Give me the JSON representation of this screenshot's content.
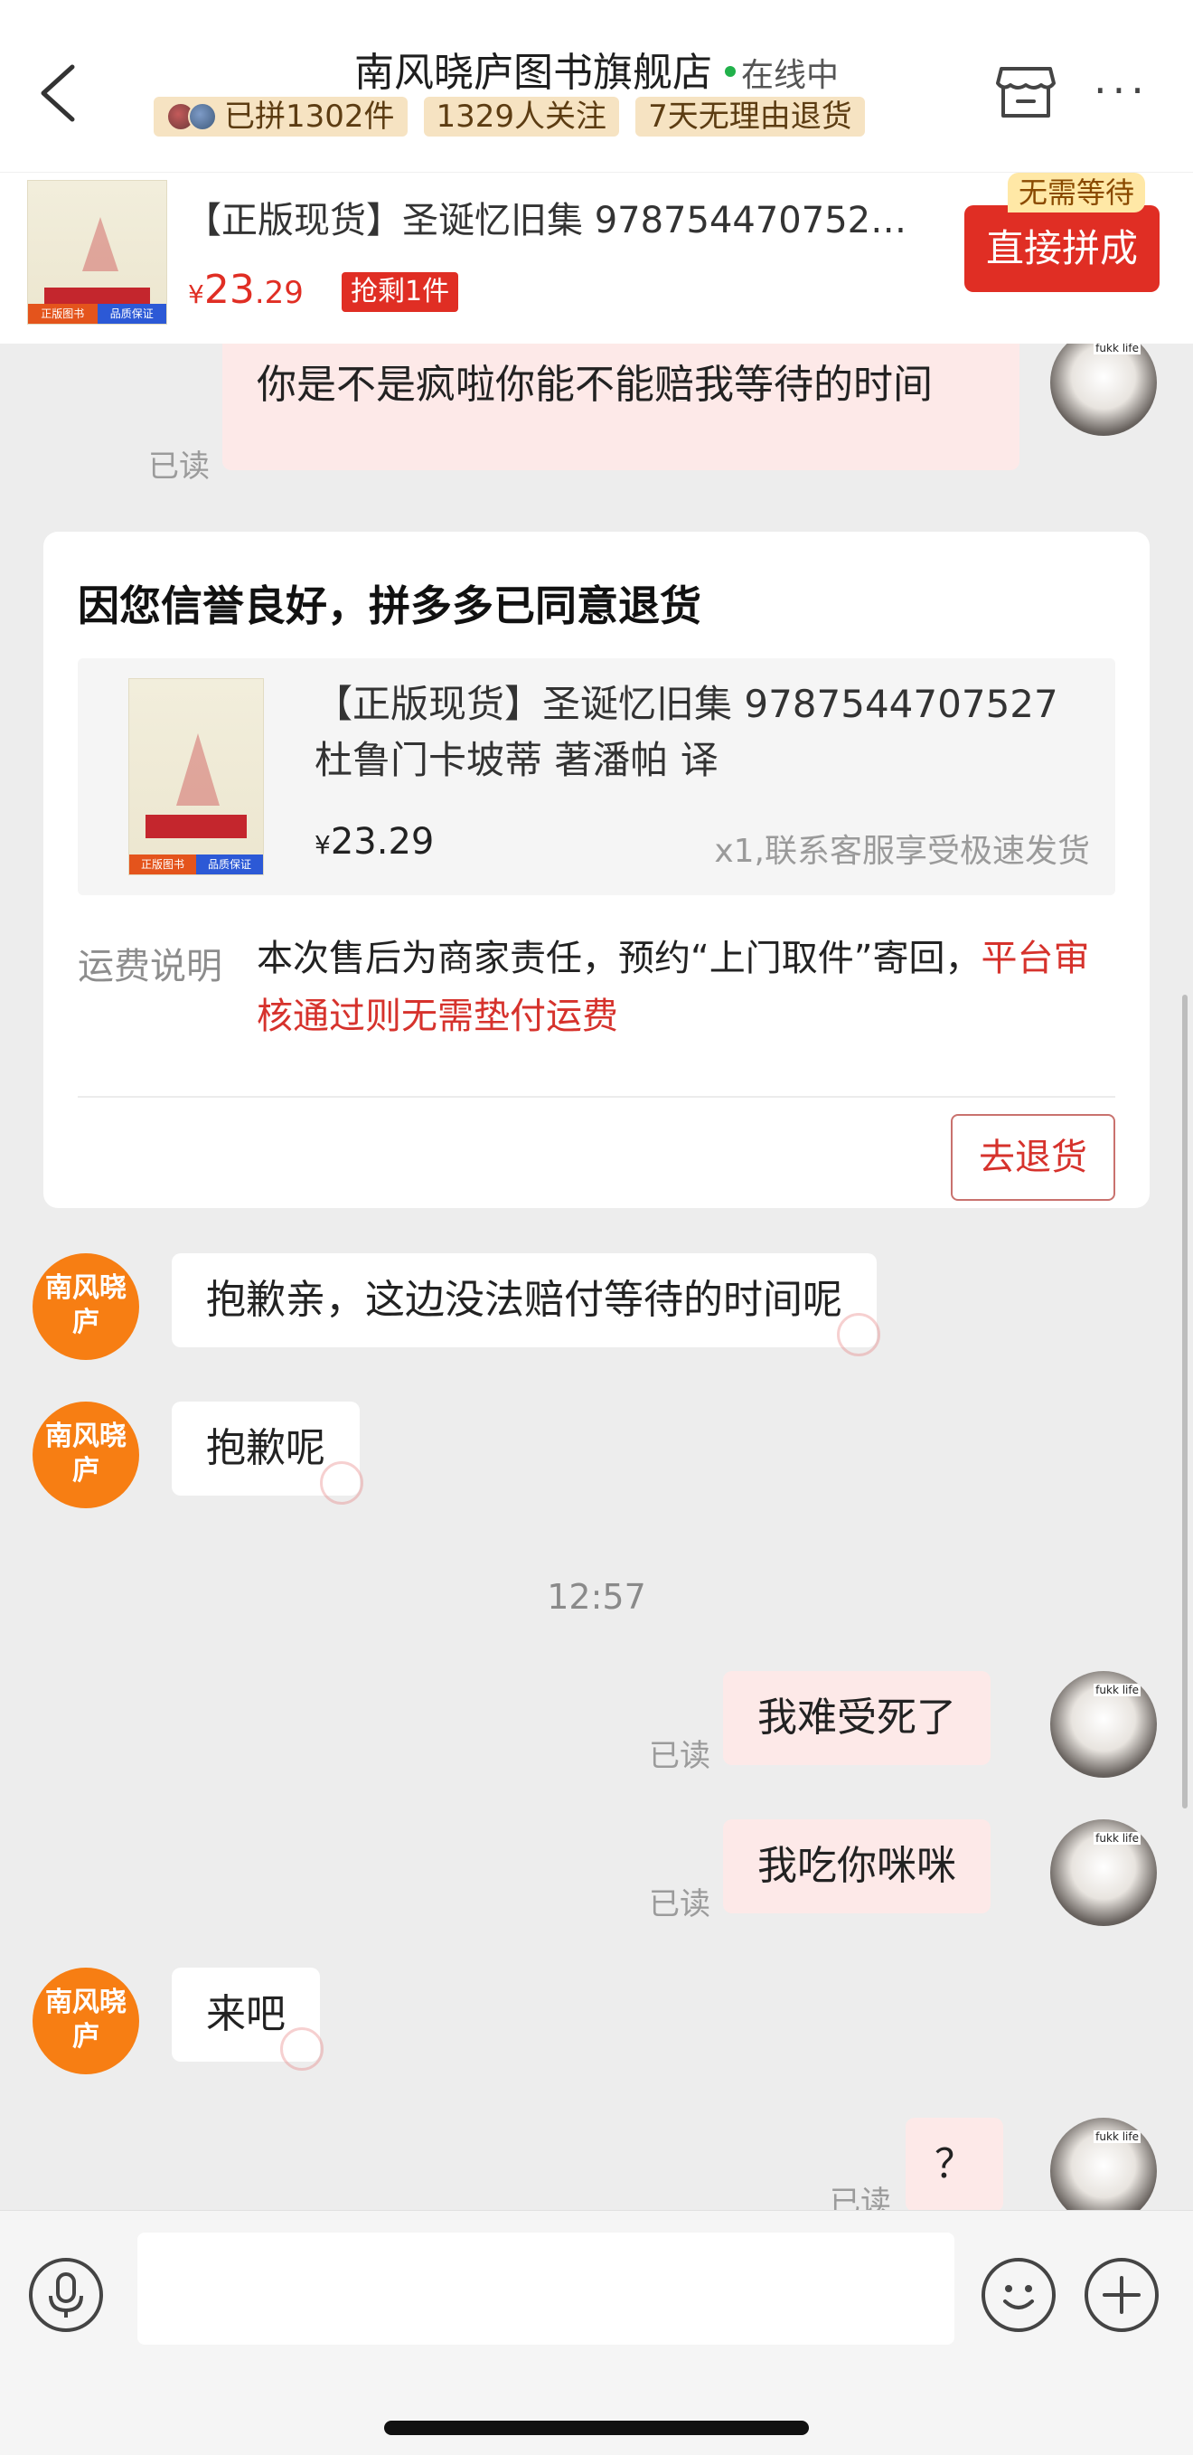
{
  "header": {
    "shop_name": "南风晓庐图书旗舰店",
    "online_status": "在线中",
    "stats": [
      "已拼1302件",
      "1329人关注",
      "7天无理由退货"
    ]
  },
  "product_bar": {
    "title": "【正版现货】圣诞忆旧集 978754470752…",
    "price_yen": "¥",
    "price_main": "23",
    "price_cents": ".29",
    "stock_tag": "抢剩1件",
    "buy_button": "直接拼成",
    "no_wait_tag": "无需等待",
    "thumb_tags": [
      "正版图书",
      "品质保证"
    ]
  },
  "chat": {
    "messages": [
      {
        "from": "me",
        "text": "你是不是疯啦你能不能赔我等待的时间",
        "read": "已读"
      },
      {
        "from": "shop",
        "text": "抱歉亲，这边没法赔付等待的时间呢"
      },
      {
        "from": "shop",
        "text": "抱歉呢"
      },
      {
        "from": "time",
        "text": "12:57"
      },
      {
        "from": "me",
        "text": "我难受死了",
        "read": "已读"
      },
      {
        "from": "me",
        "text": "我吃你咪咪",
        "read": "已读"
      },
      {
        "from": "shop",
        "text": "来吧"
      },
      {
        "from": "me",
        "text": "？",
        "read": "已读"
      }
    ],
    "shop_avatar_text": "南风晓庐",
    "user_avatar_tag": "fukk life"
  },
  "card": {
    "title": "因您信誉良好，拼多多已同意退货",
    "product_name": "【正版现货】圣诞忆旧集 9787544707527 杜鲁门卡坡蒂 著潘帕 译",
    "price_yen": "¥",
    "price": "23.29",
    "note": "x1,联系客服享受极速发货",
    "fee_label": "运费说明",
    "fee_text_normal": "本次售后为商家责任，预约“上门取件”寄回，",
    "fee_text_red": "平台审核通过则无需垫付运费",
    "return_button": "去退货",
    "thumb_tags": [
      "正版图书",
      "品质保证"
    ]
  },
  "input": {
    "placeholder": ""
  },
  "colors": {
    "accent_red": "#e02e24",
    "bubble_out": "#fde9e8",
    "shop_avatar": "#f77e13",
    "badge_bg": "#f6e3c2"
  }
}
